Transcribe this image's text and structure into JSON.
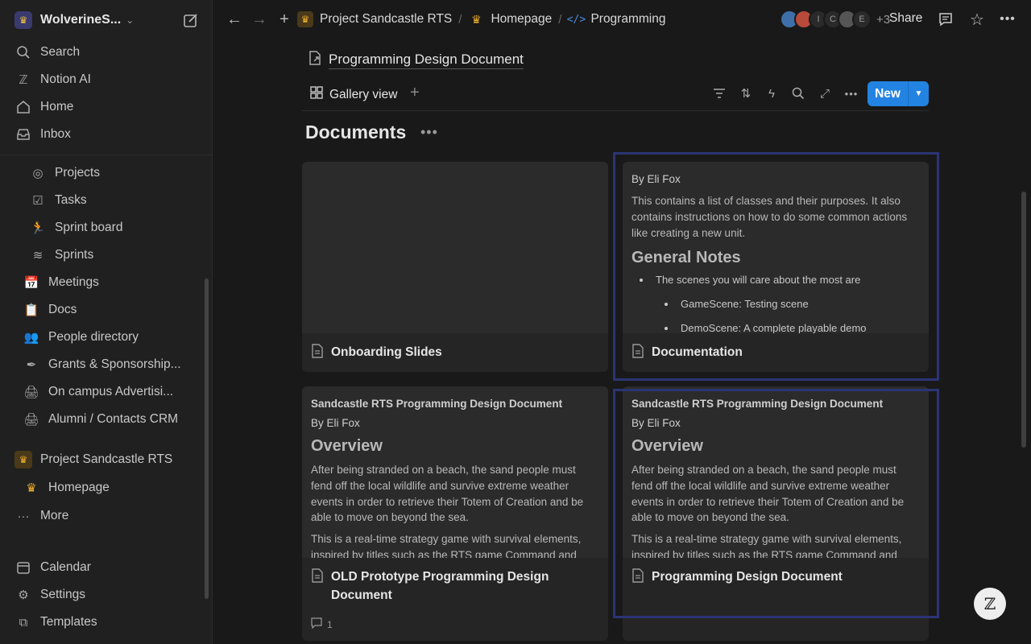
{
  "workspace": {
    "name": "WolverineS..."
  },
  "sidebar": {
    "top": [
      {
        "label": "Search",
        "icon": "search-icon"
      },
      {
        "label": "Notion AI",
        "icon": "notion-ai-icon"
      },
      {
        "label": "Home",
        "icon": "home-icon"
      },
      {
        "label": "Inbox",
        "icon": "inbox-icon"
      }
    ],
    "items": [
      {
        "label": "Projects",
        "icon": "target-icon"
      },
      {
        "label": "Tasks",
        "icon": "checkbox-icon"
      },
      {
        "label": "Sprint board",
        "icon": "runner-icon"
      },
      {
        "label": "Sprints",
        "icon": "database-icon"
      },
      {
        "label": "Meetings",
        "icon": "calendar-page-icon"
      },
      {
        "label": "Docs",
        "icon": "clipboard-icon"
      },
      {
        "label": "People directory",
        "icon": "people-icon"
      },
      {
        "label": "Grants & Sponsorship...",
        "icon": "pen-icon"
      },
      {
        "label": "On campus Advertisi...",
        "icon": "printer-icon"
      },
      {
        "label": "Alumni / Contacts CRM",
        "icon": "printer-icon"
      }
    ],
    "project": {
      "label": "Project Sandcastle RTS"
    },
    "homepage": {
      "label": "Homepage"
    },
    "more": {
      "label": "More"
    },
    "bottom": [
      {
        "label": "Calendar",
        "icon": "calendar-icon"
      },
      {
        "label": "Settings",
        "icon": "gear-icon"
      },
      {
        "label": "Templates",
        "icon": "templates-icon"
      }
    ]
  },
  "topbar": {
    "breadcrumbs": [
      {
        "label": "Project Sandcastle RTS"
      },
      {
        "label": "Homepage"
      },
      {
        "label": "Programming"
      }
    ],
    "separator": "/",
    "avatar_letters": [
      "I",
      "C",
      "E"
    ],
    "extra_count": "+3",
    "share": "Share"
  },
  "page": {
    "title": "Programming Design Document"
  },
  "view": {
    "label": "Gallery view",
    "new_label": "New"
  },
  "section": {
    "title": "Documents"
  },
  "cards": [
    {
      "title": "Onboarding Slides"
    },
    {
      "title": "Documentation",
      "by": "By Eli Fox",
      "text": "This contains a list of classes and their purposes. It also contains instructions on how to do some common actions like creating a new unit.",
      "heading": "General Notes",
      "bullet": "The scenes you will care about the most are",
      "sub": [
        "GameScene: Testing scene",
        "DemoScene: A complete playable demo"
      ]
    },
    {
      "title": "OLD Prototype Programming Design Document",
      "header": "Sandcastle RTS Programming Design Document",
      "by": "By Eli Fox",
      "heading": "Overview",
      "p1": "After being stranded on a beach, the sand people must fend off the local wildlife and survive extreme weather events in order to retrieve their Totem of Creation and be able to move on beyond the sea.",
      "p2": "This is a real-time strategy game with survival elements, inspired by titles such as the RTS game Command and",
      "comments": "1"
    },
    {
      "title": "Programming Design Document",
      "header": "Sandcastle RTS Programming Design Document",
      "by": "By Eli Fox",
      "heading": "Overview",
      "p1": "After being stranded on a beach, the sand people must fend off the local wildlife and survive extreme weather events in order to retrieve their Totem of Creation and be able to move on beyond the sea.",
      "p2": "This is a real-time strategy game with survival elements, inspired by titles such as the RTS game Command and"
    }
  ],
  "colors": {
    "accent": "#2383e2",
    "highlight": "#2b3474",
    "background": "#191919",
    "sidebar": "#202020"
  }
}
